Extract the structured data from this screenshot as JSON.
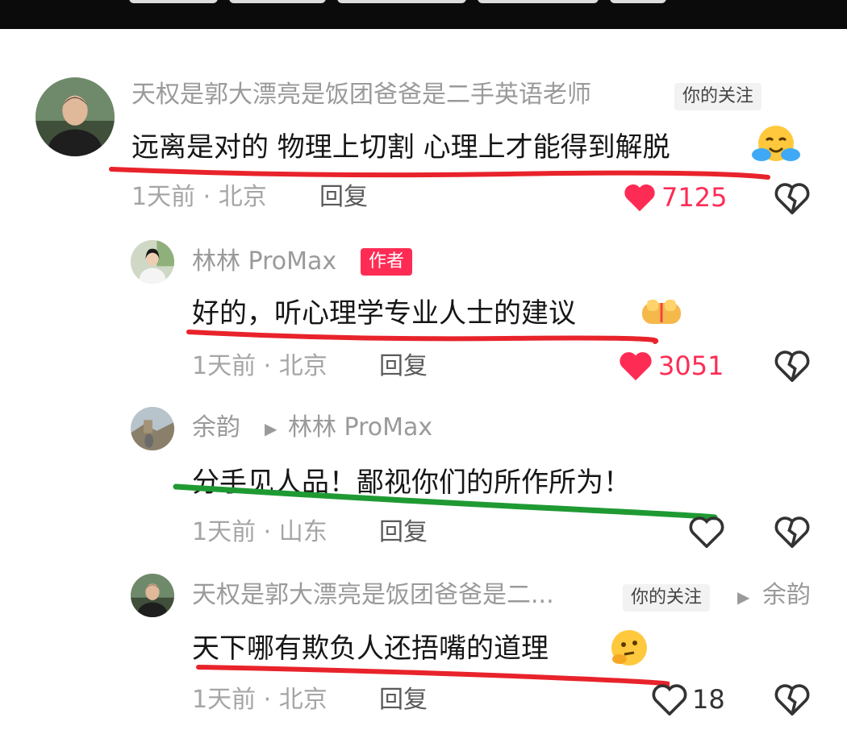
{
  "comments": [
    {
      "user": "天权是郭大漂亮是饭团爸爸是二手英语老师",
      "tag": "你的关注",
      "text": "远离是对的 物理上切割 心理上才能得到解脱",
      "meta": "1天前 · 北京",
      "reply": "回复",
      "likes": "7125"
    },
    {
      "user": "林林 ProMax",
      "tag": "作者",
      "text": "好的，听心理学专业人士的建议",
      "meta": "1天前 · 北京",
      "reply": "回复",
      "likes": "3051"
    },
    {
      "user": "余韵",
      "reply_to": "林林 ProMax",
      "text": "分手见人品！鄙视你们的所作所为！",
      "meta": "1天前 · 山东",
      "reply": "回复",
      "likes": ""
    },
    {
      "user": "天权是郭大漂亮是饭团爸爸是二...",
      "tag": "你的关注",
      "reply_to": "余韵",
      "text": "天下哪有欺负人还捂嘴的道理",
      "meta": "1天前 · 北京",
      "reply": "回复",
      "likes": "18"
    }
  ],
  "colors": {
    "liked": "#fe2c55",
    "underline_red": "#e8232b",
    "underline_green": "#1f9a33",
    "meta_gray": "#a5a5a5"
  },
  "icons": [
    "heart-filled-icon",
    "heart-outline-icon",
    "broken-heart-icon",
    "play-triangle-icon"
  ]
}
